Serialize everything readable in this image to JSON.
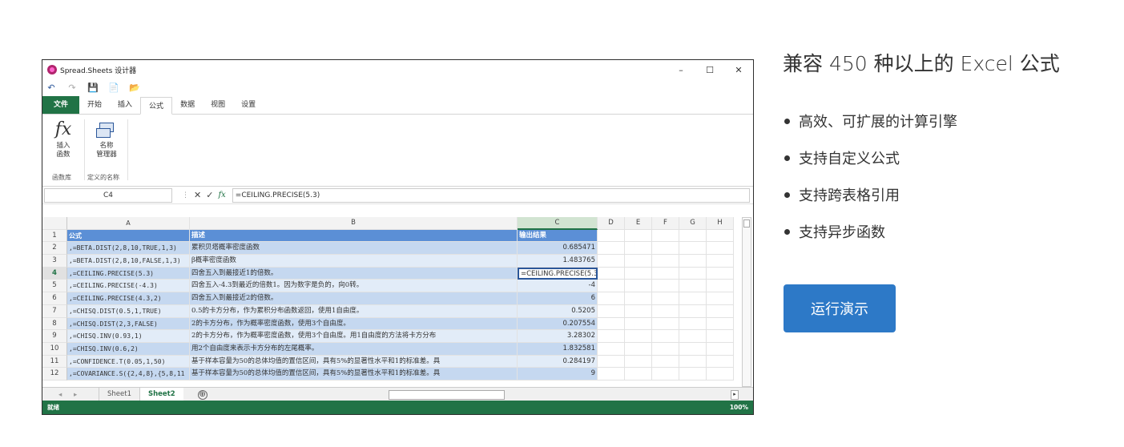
{
  "window": {
    "title": "Spread.Sheets 设计器",
    "controls": [
      "–",
      "☐",
      "✕"
    ],
    "quick_access": [
      "↶",
      "↷",
      "💾",
      "📄",
      "📂"
    ]
  },
  "ribbon": {
    "tabs": [
      "文件",
      "开始",
      "插入",
      "公式",
      "数据",
      "视图",
      "设置"
    ],
    "insert_function": {
      "icon": "fx",
      "label_line1": "插入",
      "label_line2": "函数"
    },
    "name_manager": {
      "label_line1": "名称",
      "label_line2": "管理器"
    },
    "group_function_library": "函数库",
    "group_defined_names": "定义的名称"
  },
  "formula_bar": {
    "name_box": "C4",
    "cancel": "✕",
    "enter": "✓",
    "fx": "fx",
    "formula": "=CEILING.PRECISE(5.3)"
  },
  "grid": {
    "columns": [
      "A",
      "B",
      "C",
      "D",
      "E",
      "F",
      "G",
      "H"
    ],
    "rows": [
      {
        "n": "1",
        "a": "公式",
        "b": "描述",
        "c": "输出结果"
      },
      {
        "n": "2",
        "a": ",=BETA.DIST(2,8,10,TRUE,1,3)",
        "b": "累积贝塔概率密度函数",
        "c": "0.685471"
      },
      {
        "n": "3",
        "a": ",=BETA.DIST(2,8,10,FALSE,1,3)",
        "b": "β概率密度函数",
        "c": "1.483765"
      },
      {
        "n": "4",
        "a": ",=CEILING.PRECISE(5.3)",
        "b": "四舍五入到最接近1的倍数。",
        "c": "=CEILING.PRECISE(5.3)"
      },
      {
        "n": "5",
        "a": ",=CEILING.PRECISE(-4.3)",
        "b": "四舍五入-4.3到最近的倍数1。因为数字是负的，向0转。",
        "c": "-4"
      },
      {
        "n": "6",
        "a": ",=CEILING.PRECISE(4.3,2)",
        "b": "四舍五入到最接近2的倍数。",
        "c": "6"
      },
      {
        "n": "7",
        "a": ",=CHISQ.DIST(0.5,1,TRUE)",
        "b": "0.5的卡方分布，作为累积分布函数返回，使用1自由度。",
        "c": "0.5205"
      },
      {
        "n": "8",
        "a": ",=CHISQ.DIST(2,3,FALSE)",
        "b": "2的卡方分布，作为概率密度函数，使用3个自由度。",
        "c": "0.207554"
      },
      {
        "n": "9",
        "a": ",=CHISQ.INV(0.93,1)",
        "b": "2的卡方分布，作为概率密度函数，使用3个自由度。用1自由度的方法将卡方分布",
        "c": "3.28302"
      },
      {
        "n": "10",
        "a": ",=CHISQ.INV(0.6,2)",
        "b": "用2个自由度来表示卡方分布的左尾概率。",
        "c": "1.832581"
      },
      {
        "n": "11",
        "a": ",=CONFIDENCE.T(0.05,1,50)",
        "b": "基于样本容量为50的总体均值的置信区间，具有5%的显著性水平和1的标准差。具",
        "c": "0.284197"
      },
      {
        "n": "12",
        "a": ",=COVARIANCE.S({2,4,8},{5,8,11",
        "b": "基于样本容量为50的总体均值的置信区间，具有5%的显著性水平和1的标准差。具",
        "c": "9"
      }
    ]
  },
  "sheets": {
    "nav": "◂ ▸",
    "tabs": [
      "Sheet1",
      "Sheet2"
    ],
    "active": "Sheet2",
    "add": "⊕"
  },
  "status": {
    "mode": "就绪",
    "zoom": "100%"
  },
  "panel": {
    "title": "兼容 450 种以上的 Excel 公式",
    "features": [
      "高效、可扩展的计算引擎",
      "支持自定义公式",
      "支持跨表格引用",
      "支持异步函数"
    ],
    "button_label": "运行演示",
    "button_color": "#2d79c7"
  }
}
